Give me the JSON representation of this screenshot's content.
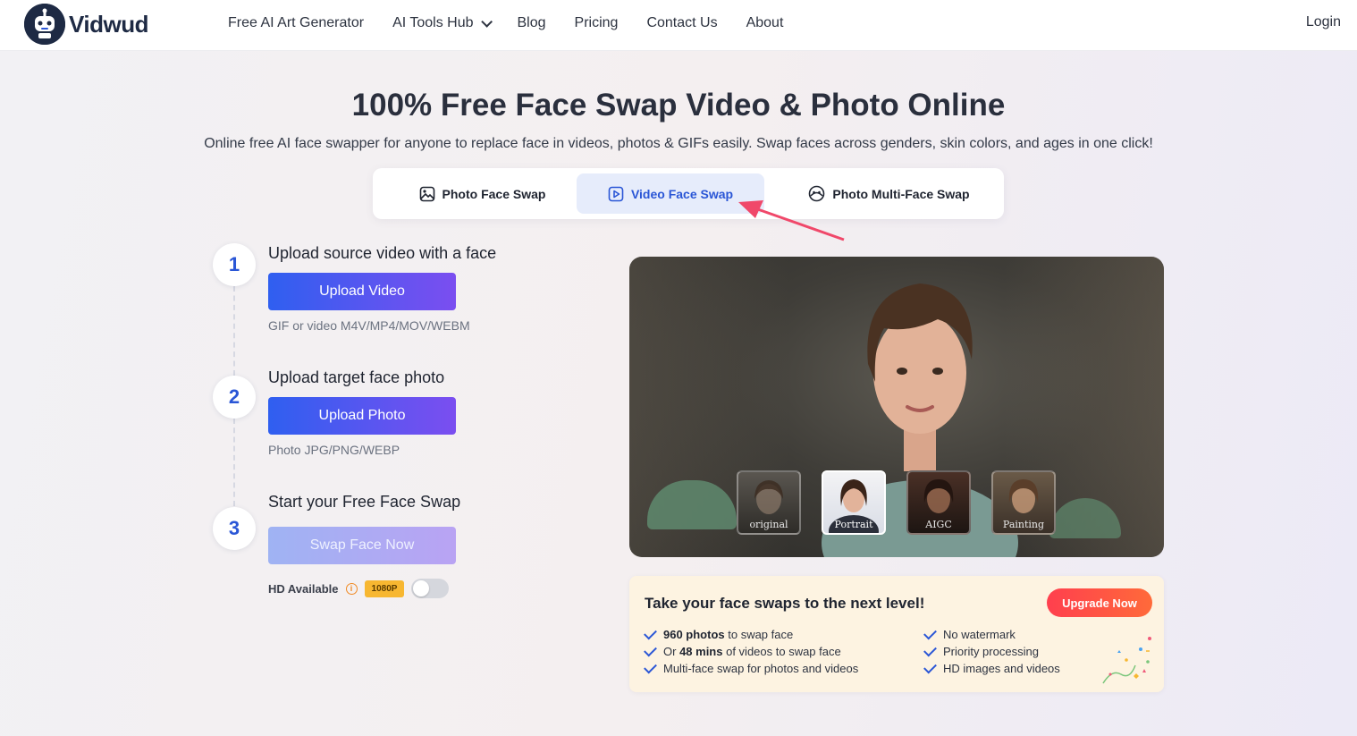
{
  "brand": {
    "name": "Vidwud"
  },
  "nav": {
    "items": [
      "Free AI Art Generator",
      "AI Tools Hub",
      "Blog",
      "Pricing",
      "Contact Us",
      "About"
    ],
    "login": "Login"
  },
  "hero": {
    "title": "100% Free Face Swap Video & Photo Online",
    "subtitle": "Online free AI face swapper for anyone to replace face in videos, photos & GIFs easily. Swap faces across genders, skin colors, and ages in one click!"
  },
  "tabs": [
    {
      "label": "Photo Face Swap",
      "icon": "image-icon",
      "active": false
    },
    {
      "label": "Video Face Swap",
      "icon": "play-icon",
      "active": true
    },
    {
      "label": "Photo Multi-Face Swap",
      "icon": "multi-face-icon",
      "active": false
    }
  ],
  "steps": [
    {
      "number": "1",
      "title": "Upload source video with a face",
      "button": "Upload Video",
      "hint": "GIF or video M4V/MP4/MOV/WEBM"
    },
    {
      "number": "2",
      "title": "Upload target face photo",
      "button": "Upload Photo",
      "hint": "Photo JPG/PNG/WEBP"
    },
    {
      "number": "3",
      "title": "Start your Free Face Swap",
      "button": "Swap Face Now"
    }
  ],
  "hd": {
    "label": "HD Available",
    "info": "i",
    "badge": "1080P",
    "enabled": false
  },
  "preview": {
    "thumbnails": [
      {
        "label": "original",
        "active": false
      },
      {
        "label": "Portrait",
        "active": true
      },
      {
        "label": "AIGC",
        "active": false
      },
      {
        "label": "Painting",
        "active": false
      }
    ]
  },
  "upgrade": {
    "title": "Take your face swaps to the next level!",
    "button": "Upgrade Now",
    "left_features": [
      {
        "bold": "960 photos",
        "text": " to swap face",
        "prefix": ""
      },
      {
        "prefix": "Or ",
        "bold": "48 mins",
        "text": " of videos to swap face"
      },
      {
        "prefix": "",
        "bold": "",
        "text": "Multi-face swap for photos and videos"
      }
    ],
    "right_features": [
      "No watermark",
      "Priority processing",
      "HD images and videos"
    ]
  },
  "colors": {
    "accent": "#2a56d6",
    "gradient_start": "#2f5ff0",
    "gradient_end": "#7b4ef0",
    "upgrade_button": "#ff3f4e",
    "badge": "#f7b731"
  }
}
